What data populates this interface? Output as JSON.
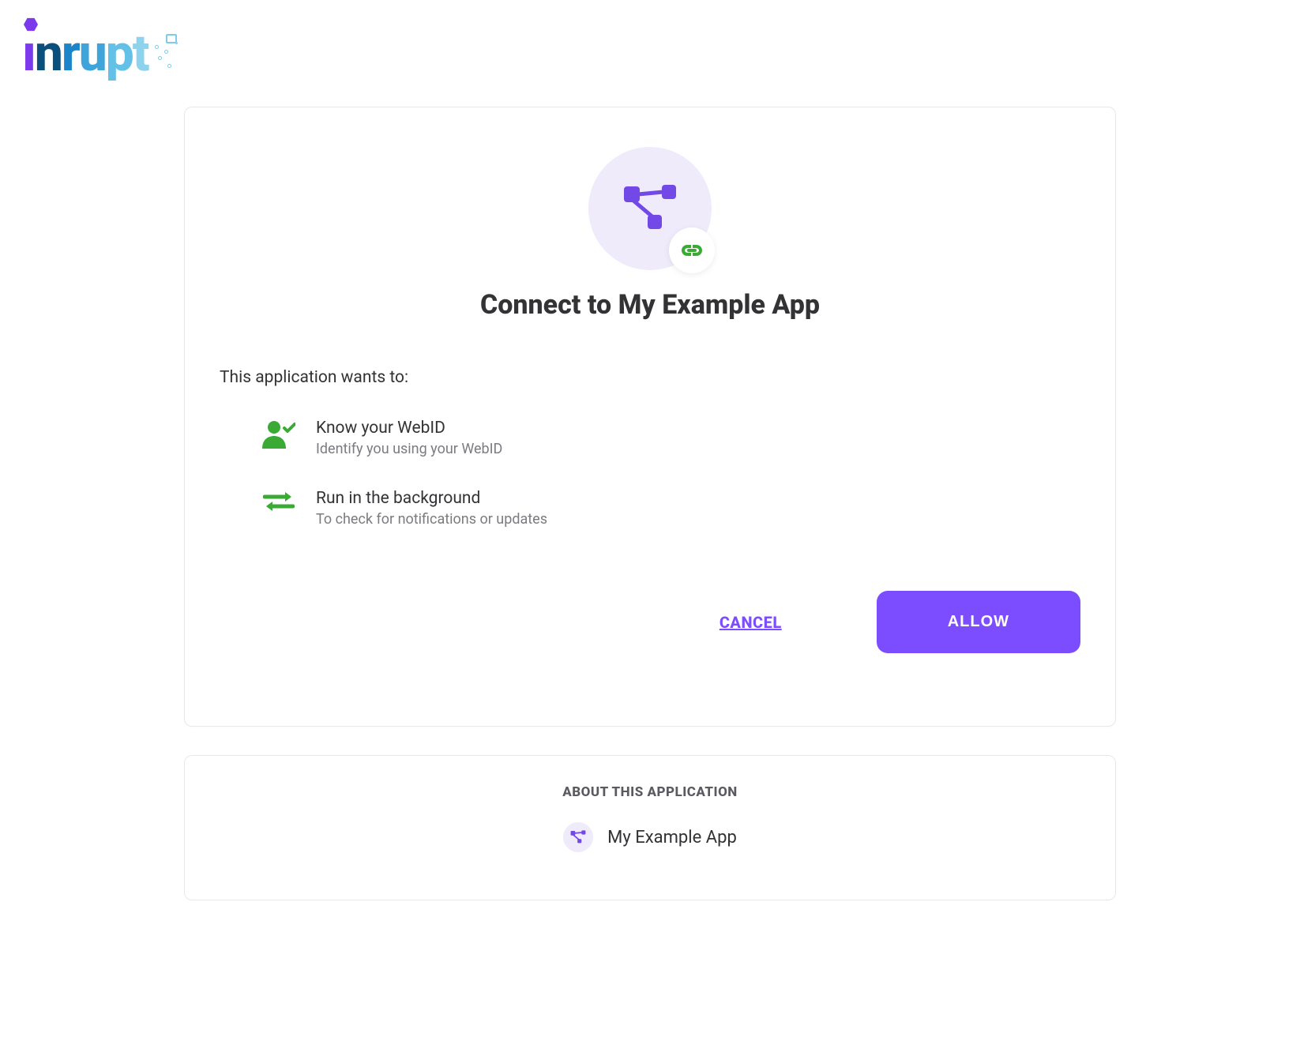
{
  "brand": "inrupt",
  "dialog": {
    "title": "Connect to My Example App",
    "intro": "This application wants to:",
    "permissions": [
      {
        "icon": "user-check-icon",
        "title": "Know your WebID",
        "desc": "Identify you using your WebID"
      },
      {
        "icon": "exchange-icon",
        "title": "Run in the background",
        "desc": "To check for notifications or updates"
      }
    ],
    "cancel_label": "CANCEL",
    "allow_label": "ALLOW"
  },
  "about": {
    "heading": "ABOUT THIS APPLICATION",
    "app_name": "My Example App"
  },
  "colors": {
    "accent_purple": "#7c4dff",
    "accent_green": "#3aaa35"
  }
}
